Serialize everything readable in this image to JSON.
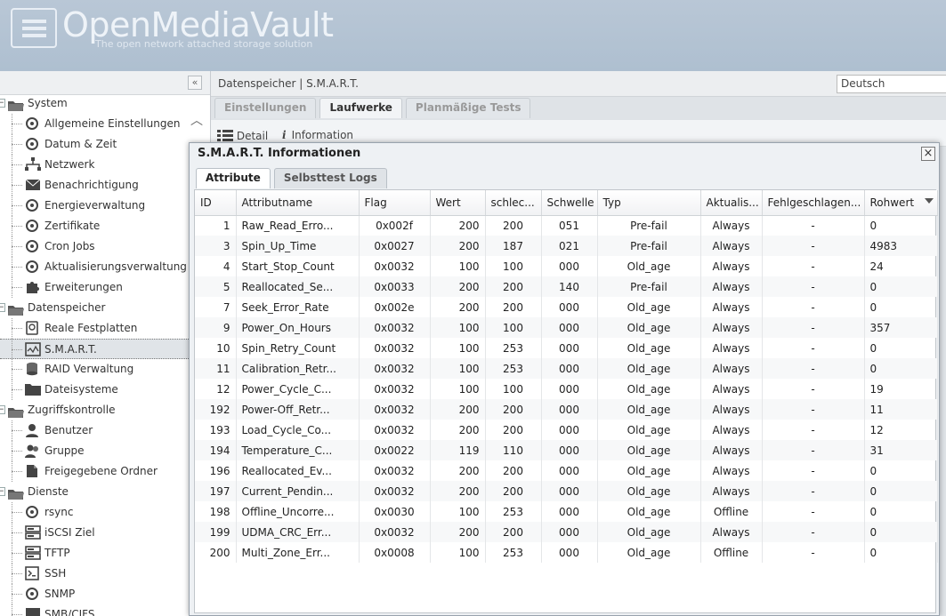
{
  "header": {
    "logo_title": "OpenMediaVault",
    "logo_subtitle": "The open network attached storage solution"
  },
  "sidebar": {
    "collapse_label": "«",
    "items": [
      {
        "type": "group",
        "label": "System",
        "icon": "folder-icon"
      },
      {
        "type": "leaf",
        "label": "Allgemeine Einstellungen",
        "icon": "gears-icon"
      },
      {
        "type": "leaf",
        "label": "Datum & Zeit",
        "icon": "clock-icon"
      },
      {
        "type": "leaf",
        "label": "Netzwerk",
        "icon": "network-icon"
      },
      {
        "type": "leaf",
        "label": "Benachrichtigung",
        "icon": "mail-icon"
      },
      {
        "type": "leaf",
        "label": "Energieverwaltung",
        "icon": "power-icon"
      },
      {
        "type": "leaf",
        "label": "Zertifikate",
        "icon": "certificate-icon"
      },
      {
        "type": "leaf",
        "label": "Cron Jobs",
        "icon": "clock-icon"
      },
      {
        "type": "leaf",
        "label": "Aktualisierungsverwaltung",
        "icon": "update-icon"
      },
      {
        "type": "leaf",
        "label": "Erweiterungen",
        "icon": "puzzle-icon"
      },
      {
        "type": "group",
        "label": "Datenspeicher",
        "icon": "folder-icon"
      },
      {
        "type": "leaf",
        "label": "Reale Festplatten",
        "icon": "disk-icon"
      },
      {
        "type": "leaf",
        "label": "S.M.A.R.T.",
        "icon": "smart-icon",
        "selected": true
      },
      {
        "type": "leaf",
        "label": "RAID Verwaltung",
        "icon": "raid-icon"
      },
      {
        "type": "leaf",
        "label": "Dateisysteme",
        "icon": "filesystem-icon"
      },
      {
        "type": "group",
        "label": "Zugriffskontrolle",
        "icon": "folder-icon"
      },
      {
        "type": "leaf",
        "label": "Benutzer",
        "icon": "user-icon"
      },
      {
        "type": "leaf",
        "label": "Gruppe",
        "icon": "group-icon"
      },
      {
        "type": "leaf",
        "label": "Freigegebene Ordner",
        "icon": "shared-folder-icon"
      },
      {
        "type": "group",
        "label": "Dienste",
        "icon": "folder-icon"
      },
      {
        "type": "leaf",
        "label": "rsync",
        "icon": "rsync-icon"
      },
      {
        "type": "leaf",
        "label": "iSCSI Ziel",
        "icon": "server-icon"
      },
      {
        "type": "leaf",
        "label": "TFTP",
        "icon": "server-icon"
      },
      {
        "type": "leaf",
        "label": "SSH",
        "icon": "terminal-icon"
      },
      {
        "type": "leaf",
        "label": "SNMP",
        "icon": "gear-icon"
      },
      {
        "type": "leaf",
        "label": "SMB/CIFS",
        "icon": "windows-icon"
      }
    ]
  },
  "main": {
    "breadcrumb": "Datenspeicher | S.M.A.R.T.",
    "language": "Deutsch",
    "tabs": [
      {
        "label": "Einstellungen",
        "active": false
      },
      {
        "label": "Laufwerke",
        "active": true
      },
      {
        "label": "Planmäßige Tests",
        "active": false
      }
    ],
    "toolbar": {
      "detail_label": "Detail",
      "information_label": "Information"
    }
  },
  "modal": {
    "title": "S.M.A.R.T. Informationen",
    "close_label": "×",
    "tabs": [
      {
        "label": "Attribute",
        "active": true
      },
      {
        "label": "Selbsttest Logs",
        "active": false
      }
    ],
    "columns": [
      "ID",
      "Attributname",
      "Flag",
      "Wert",
      "schlec...",
      "Schwelle",
      "Typ",
      "Aktualis...",
      "Fehlgeschlagen...",
      "Rohwert"
    ],
    "rows": [
      [
        "1",
        "Raw_Read_Erro...",
        "0x002f",
        "200",
        "200",
        "051",
        "Pre-fail",
        "Always",
        "-",
        "0"
      ],
      [
        "3",
        "Spin_Up_Time",
        "0x0027",
        "200",
        "187",
        "021",
        "Pre-fail",
        "Always",
        "-",
        "4983"
      ],
      [
        "4",
        "Start_Stop_Count",
        "0x0032",
        "100",
        "100",
        "000",
        "Old_age",
        "Always",
        "-",
        "24"
      ],
      [
        "5",
        "Reallocated_Se...",
        "0x0033",
        "200",
        "200",
        "140",
        "Pre-fail",
        "Always",
        "-",
        "0"
      ],
      [
        "7",
        "Seek_Error_Rate",
        "0x002e",
        "200",
        "200",
        "000",
        "Old_age",
        "Always",
        "-",
        "0"
      ],
      [
        "9",
        "Power_On_Hours",
        "0x0032",
        "100",
        "100",
        "000",
        "Old_age",
        "Always",
        "-",
        "357"
      ],
      [
        "10",
        "Spin_Retry_Count",
        "0x0032",
        "100",
        "253",
        "000",
        "Old_age",
        "Always",
        "-",
        "0"
      ],
      [
        "11",
        "Calibration_Retr...",
        "0x0032",
        "100",
        "253",
        "000",
        "Old_age",
        "Always",
        "-",
        "0"
      ],
      [
        "12",
        "Power_Cycle_C...",
        "0x0032",
        "100",
        "100",
        "000",
        "Old_age",
        "Always",
        "-",
        "19"
      ],
      [
        "192",
        "Power-Off_Retr...",
        "0x0032",
        "200",
        "200",
        "000",
        "Old_age",
        "Always",
        "-",
        "11"
      ],
      [
        "193",
        "Load_Cycle_Co...",
        "0x0032",
        "200",
        "200",
        "000",
        "Old_age",
        "Always",
        "-",
        "12"
      ],
      [
        "194",
        "Temperature_C...",
        "0x0022",
        "119",
        "110",
        "000",
        "Old_age",
        "Always",
        "-",
        "31"
      ],
      [
        "196",
        "Reallocated_Ev...",
        "0x0032",
        "200",
        "200",
        "000",
        "Old_age",
        "Always",
        "-",
        "0"
      ],
      [
        "197",
        "Current_Pendin...",
        "0x0032",
        "200",
        "200",
        "000",
        "Old_age",
        "Always",
        "-",
        "0"
      ],
      [
        "198",
        "Offline_Uncorre...",
        "0x0030",
        "100",
        "253",
        "000",
        "Old_age",
        "Offline",
        "-",
        "0"
      ],
      [
        "199",
        "UDMA_CRC_Err...",
        "0x0032",
        "200",
        "200",
        "000",
        "Old_age",
        "Always",
        "-",
        "0"
      ],
      [
        "200",
        "Multi_Zone_Err...",
        "0x0008",
        "100",
        "253",
        "000",
        "Old_age",
        "Offline",
        "-",
        "0"
      ]
    ]
  }
}
